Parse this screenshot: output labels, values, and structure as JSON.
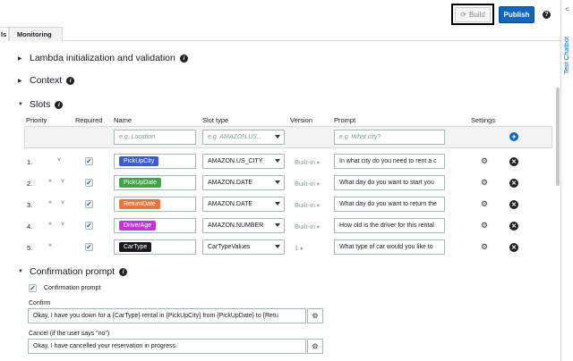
{
  "toolbar": {
    "build_label": "Build",
    "publish_label": "Publish",
    "help_glyph": "?"
  },
  "tabs": {
    "cut_label": "ls",
    "monitoring_label": "Monitoring"
  },
  "sections": {
    "lambda": "Lambda initialization and validation",
    "context": "Context",
    "slots": "Slots",
    "confirmation": "Confirmation prompt"
  },
  "columns": {
    "priority": "Priority",
    "required": "Required",
    "name": "Name",
    "slot_type": "Slot type",
    "version": "Version",
    "prompt": "Prompt",
    "settings": "Settings"
  },
  "new_slot": {
    "name_placeholder": "e.g. Location",
    "type_placeholder": "e.g. AMAZON.US...",
    "prompt_placeholder": "e.g. What city?"
  },
  "slots": [
    {
      "num": "1.",
      "arrows": "˅",
      "name": "PickUpCity",
      "color": "#3b5bdb",
      "type": "AMAZON.US_CITY",
      "version": "Built-in",
      "prompt": "In what city do you need to rent a c"
    },
    {
      "num": "2.",
      "arrows": "˄ ˅",
      "name": "PickUpDate",
      "color": "#40a347",
      "type": "AMAZON.DATE",
      "version": "Built-in",
      "prompt": "What day do you want to start you"
    },
    {
      "num": "3.",
      "arrows": "˄ ˅",
      "name": "ReturnDate",
      "color": "#e8743b",
      "type": "AMAZON.DATE",
      "version": "Built-in",
      "prompt": "What day do you want to return the"
    },
    {
      "num": "4.",
      "arrows": "˄ ˅",
      "name": "DriverAge",
      "color": "#c233d9",
      "type": "AMAZON.NUMBER",
      "version": "Built-in",
      "prompt": "How old is the driver for this rental"
    },
    {
      "num": "5.",
      "arrows": "˄",
      "name": "CarType",
      "color": "#16191f",
      "type": "CarTypeValues",
      "version": "1",
      "prompt": "What type of car would you like to"
    }
  ],
  "confirmation": {
    "checkbox_label": "Confirmation prompt",
    "confirm_label": "Confirm",
    "confirm_value": "Okay, I have you down for a {CarType} rental in {PickUpCity} from {PickUpDate} to {Retu",
    "cancel_label": "Cancel (if the user says \"no\")",
    "cancel_value": "Okay, I have cancelled your reservation in progress."
  },
  "sidebar": {
    "chatbot_label": "Test Chatbot",
    "chevron": "<"
  },
  "colors": {
    "accent": "#1166bb"
  }
}
